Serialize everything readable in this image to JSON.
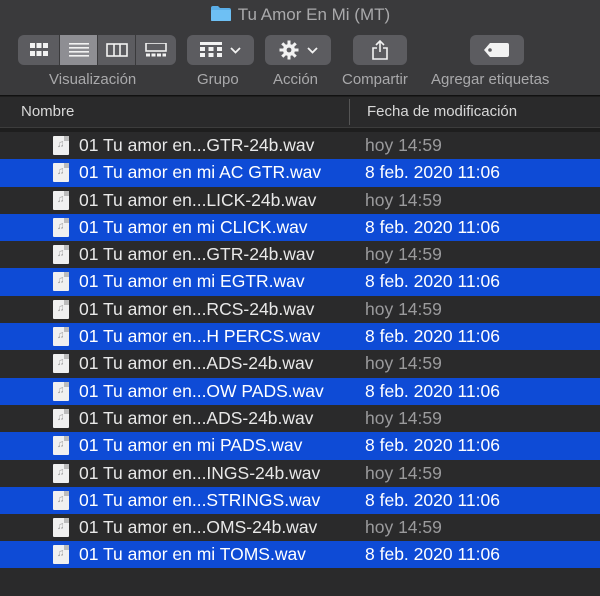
{
  "window": {
    "title": "Tu Amor En Mi (MT)"
  },
  "toolbar": {
    "view_label": "Visualización",
    "group_label": "Grupo",
    "action_label": "Acción",
    "share_label": "Compartir",
    "tags_label": "Agregar etiquetas"
  },
  "columns": {
    "name": "Nombre",
    "date": "Fecha de modificación"
  },
  "files": [
    {
      "name": "01 Tu amor en...GTR-24b.wav",
      "date": "hoy 14:59",
      "selected": false
    },
    {
      "name": "01 Tu amor en mi AC GTR.wav",
      "date": "8 feb. 2020 11:06",
      "selected": true
    },
    {
      "name": "01 Tu amor en...LICK-24b.wav",
      "date": "hoy 14:59",
      "selected": false
    },
    {
      "name": "01 Tu amor en mi CLICK.wav",
      "date": "8 feb. 2020 11:06",
      "selected": true
    },
    {
      "name": "01 Tu amor en...GTR-24b.wav",
      "date": "hoy 14:59",
      "selected": false
    },
    {
      "name": "01 Tu amor en mi EGTR.wav",
      "date": "8 feb. 2020 11:06",
      "selected": true
    },
    {
      "name": "01 Tu amor en...RCS-24b.wav",
      "date": "hoy 14:59",
      "selected": false
    },
    {
      "name": "01 Tu amor en...H PERCS.wav",
      "date": "8 feb. 2020 11:06",
      "selected": true
    },
    {
      "name": "01 Tu amor en...ADS-24b.wav",
      "date": "hoy 14:59",
      "selected": false
    },
    {
      "name": "01 Tu amor en...OW PADS.wav",
      "date": "8 feb. 2020 11:06",
      "selected": true
    },
    {
      "name": "01 Tu amor en...ADS-24b.wav",
      "date": "hoy 14:59",
      "selected": false
    },
    {
      "name": "01 Tu amor en mi PADS.wav",
      "date": "8 feb. 2020 11:06",
      "selected": true
    },
    {
      "name": "01 Tu amor en...INGS-24b.wav",
      "date": "hoy 14:59",
      "selected": false
    },
    {
      "name": "01 Tu amor en...STRINGS.wav",
      "date": "8 feb. 2020 11:06",
      "selected": true
    },
    {
      "name": "01 Tu amor en...OMS-24b.wav",
      "date": "hoy 14:59",
      "selected": false
    },
    {
      "name": "01 Tu amor en mi TOMS.wav",
      "date": "8 feb. 2020 11:06",
      "selected": true
    }
  ],
  "colors": {
    "selection": "#0e4bd6",
    "toolbar": "#3a3a3c",
    "folder": "#5aaee8"
  }
}
